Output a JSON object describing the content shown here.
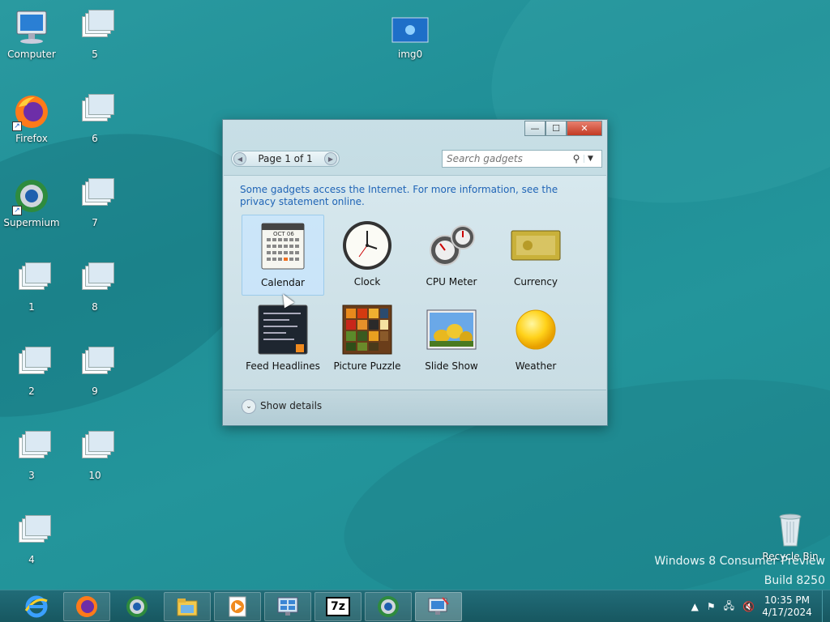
{
  "desktop": {
    "icons": [
      {
        "label": "Computer",
        "icon": "computer-icon"
      },
      {
        "label": "Firefox",
        "icon": "firefox-icon"
      },
      {
        "label": "Supermium",
        "icon": "supermium-icon"
      },
      {
        "label": "1",
        "icon": "file-icon"
      },
      {
        "label": "2",
        "icon": "file-icon"
      },
      {
        "label": "3",
        "icon": "file-icon"
      },
      {
        "label": "4",
        "icon": "file-icon"
      },
      {
        "label": "5",
        "icon": "file-icon"
      },
      {
        "label": "6",
        "icon": "file-icon"
      },
      {
        "label": "7",
        "icon": "file-icon"
      },
      {
        "label": "8",
        "icon": "file-icon"
      },
      {
        "label": "9",
        "icon": "file-icon"
      },
      {
        "label": "10",
        "icon": "file-icon"
      },
      {
        "label": "img0",
        "icon": "image-icon"
      },
      {
        "label": "Recycle Bin",
        "icon": "recycle-bin-icon"
      }
    ],
    "watermark": {
      "line1": "Windows 8 Consumer Preview",
      "line2": "Build 8250"
    }
  },
  "gadgets_window": {
    "pager_text": "Page 1 of 1",
    "search_placeholder": "Search gadgets",
    "notice": "Some gadgets access the Internet.  For more information, see the privacy statement online.",
    "gadgets": [
      {
        "label": "Calendar",
        "selected": true
      },
      {
        "label": "Clock"
      },
      {
        "label": "CPU Meter"
      },
      {
        "label": "Currency"
      },
      {
        "label": "Feed Headlines"
      },
      {
        "label": "Picture Puzzle"
      },
      {
        "label": "Slide Show"
      },
      {
        "label": "Weather"
      }
    ],
    "calendar_month": "OCT 06",
    "calendar_days": [
      "S",
      "M",
      "T",
      "W",
      "T",
      "F",
      "S"
    ],
    "show_details_label": "Show details",
    "close_symbol": "✕",
    "min_symbol": "—",
    "max_symbol": "☐"
  },
  "taskbar": {
    "time": "10:35 PM",
    "date": "4/17/2024",
    "apps": [
      "internet-explorer-icon",
      "firefox-icon",
      "supermium-icon",
      "file-explorer-icon",
      "media-player-icon",
      "control-panel-icon",
      "7zip-icon",
      "supermium-icon",
      "remote-desktop-icon"
    ],
    "label_7z": "7z"
  },
  "colors": {
    "desktop": "#2a9aa0",
    "taskbar": "#1b6570",
    "link": "#1f64b6",
    "close_button": "#c23a24"
  }
}
